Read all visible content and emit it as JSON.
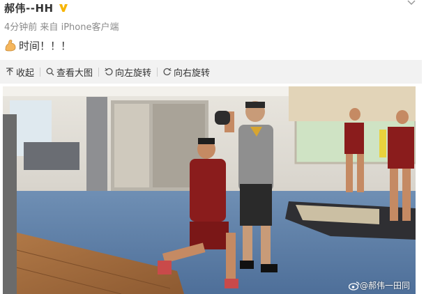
{
  "post": {
    "author": "郝伟--HH",
    "verified_badge": "V",
    "time": "4分钟前",
    "source_prefix": "来自",
    "source": "iPhone客户端",
    "text": "时间！！！",
    "emoji": "flexed-biceps-icon"
  },
  "toolbar": {
    "items": [
      {
        "label": "收起",
        "icon": "collapse-icon"
      },
      {
        "label": "查看大图",
        "icon": "search-icon"
      },
      {
        "label": "向左旋转",
        "icon": "rotate-left-icon"
      },
      {
        "label": "向右旋转",
        "icon": "rotate-right-icon"
      }
    ]
  },
  "photo": {
    "watermark": "@郝伟一田同",
    "watermark_icon": "weibo-icon"
  },
  "colors": {
    "author": "#333333",
    "meta": "#8a8a8a",
    "toolbar_bg": "#f2f2f2",
    "badge": "#f7b500"
  }
}
